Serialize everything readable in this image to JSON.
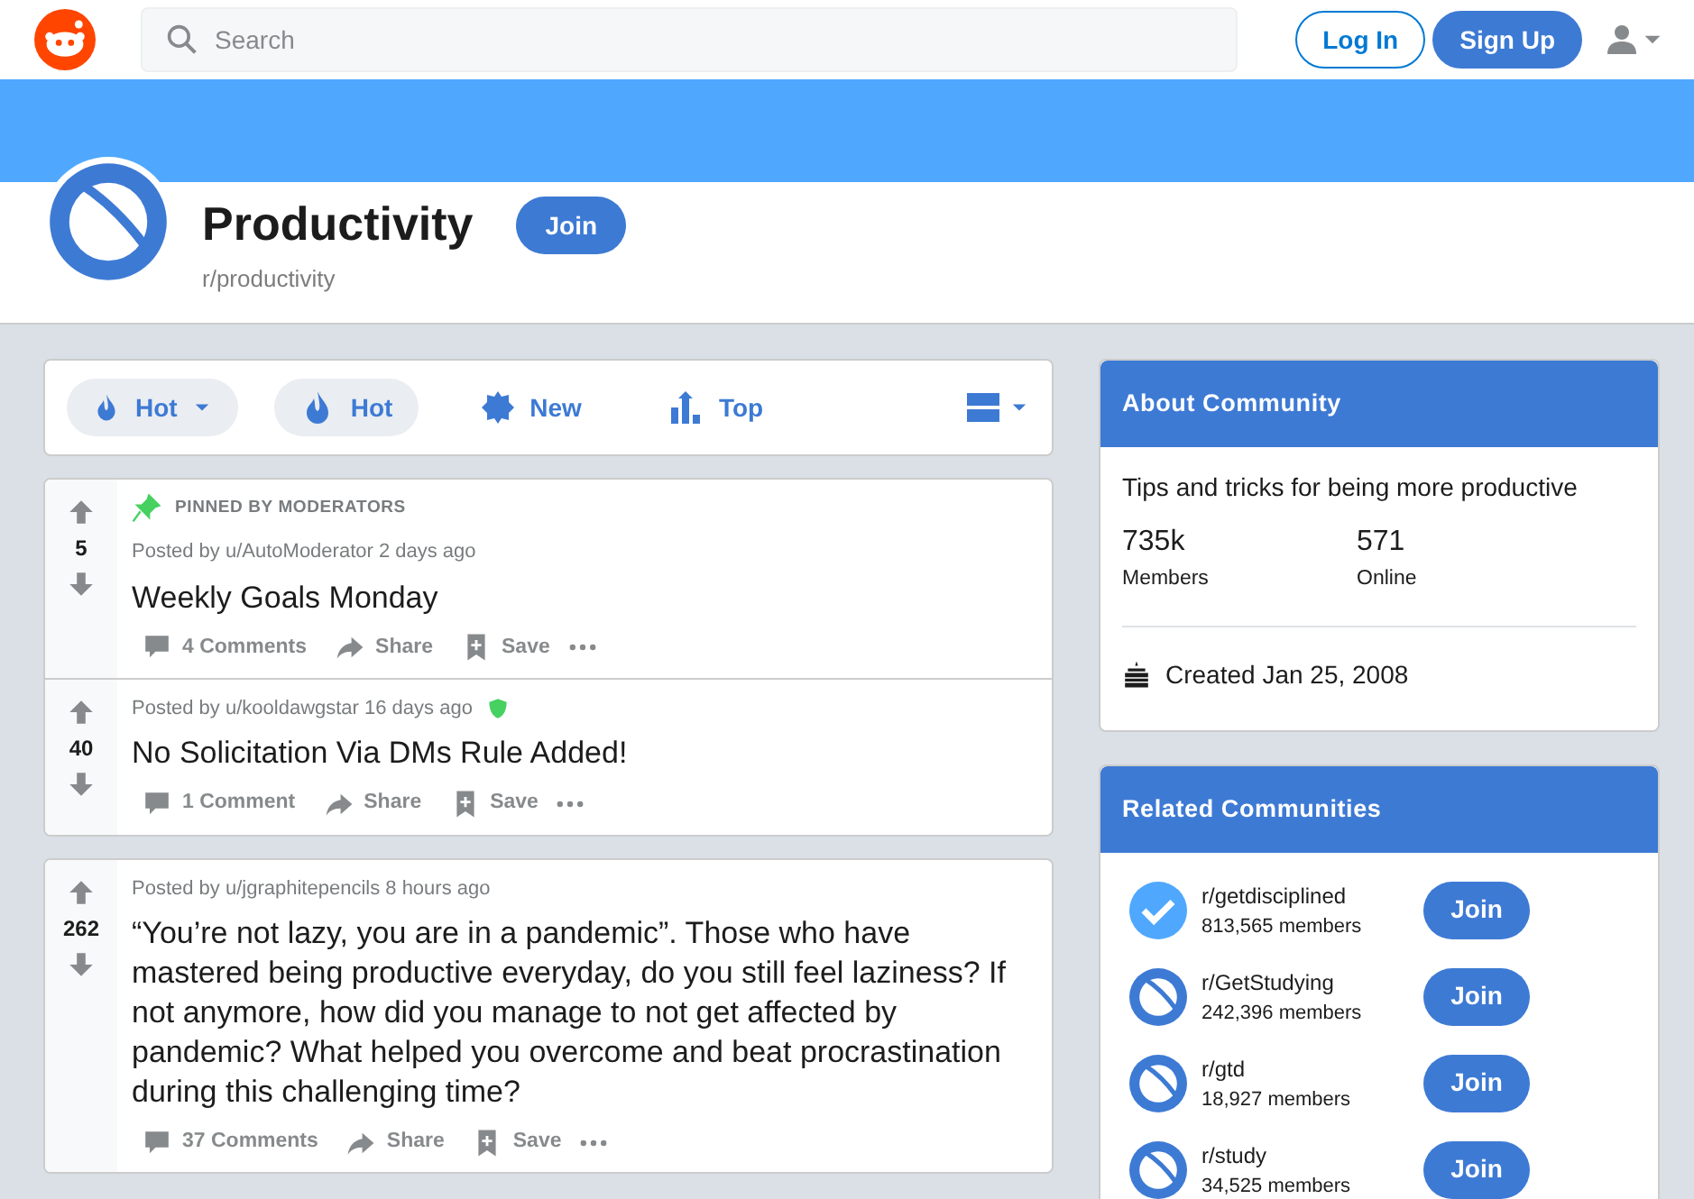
{
  "header": {
    "search": {
      "placeholder": "Search"
    },
    "buttons": [
      {
        "label": "Log In",
        "kind": "outline"
      },
      {
        "label": "Sign Up",
        "kind": "filled"
      }
    ]
  },
  "community": {
    "title": "Productivity",
    "join": "Join",
    "name": "r/productivity"
  },
  "sort_bar": [
    {
      "label": "Hot",
      "kind": "dropdown",
      "selected": true
    },
    {
      "label": "Hot",
      "kind": "option",
      "selected": true
    },
    {
      "label": "New",
      "kind": "option",
      "selected": false
    },
    {
      "label": "Top",
      "kind": "option",
      "selected": false
    }
  ],
  "posts": [
    {
      "pinned": true,
      "pinned_label": "PINNED BY MODERATORS",
      "score": "5",
      "meta": "Posted by u/AutoModerator 2 days ago",
      "moderator": false,
      "title": "Weekly Goals Monday",
      "actions": [
        "4 Comments",
        "Share",
        "Save"
      ]
    },
    {
      "pinned": false,
      "score": "40",
      "meta": "Posted by u/kooldawgstar 16 days ago",
      "moderator": true,
      "title": "No Solicitation Via DMs Rule Added!",
      "actions": [
        "1 Comment",
        "Share",
        "Save"
      ]
    },
    {
      "pinned": false,
      "score": "262",
      "meta": "Posted by u/jgraphitepencils 8 hours ago",
      "moderator": false,
      "title": "“You’re not lazy, you are in a pandemic”. Those who have mastered being productive everyday, do you still feel laziness? If not anymore, how did you manage to not get affected by pandemic? What helped you overcome and beat procrastination during this challenging time?",
      "actions": [
        "37 Comments",
        "Share",
        "Save"
      ]
    }
  ],
  "about": {
    "title": "About Community",
    "description": "Tips and tricks for being more productive",
    "stats": [
      {
        "value": "735k",
        "label": "Members"
      },
      {
        "value": "571",
        "label": "Online"
      }
    ],
    "created": "Created Jan 25, 2008"
  },
  "related": {
    "title": "Related Communities",
    "items": [
      {
        "name": "r/getdisciplined",
        "members": "813,565 members",
        "kind": "verified",
        "join": "Join"
      },
      {
        "name": "r/GetStudying",
        "members": "242,396 members",
        "kind": "default",
        "join": "Join"
      },
      {
        "name": "r/gtd",
        "members": "18,927 members",
        "kind": "default",
        "join": "Join"
      },
      {
        "name": "r/study",
        "members": "34,525 members",
        "kind": "default",
        "join": "Join"
      }
    ]
  }
}
